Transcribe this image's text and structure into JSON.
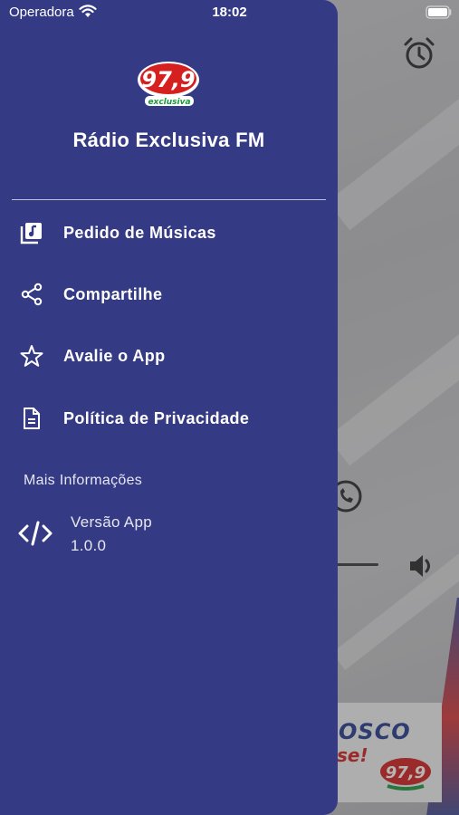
{
  "status_bar": {
    "carrier": "Operadora",
    "time": "18:02"
  },
  "drawer": {
    "logo_text": "97,9",
    "logo_subtext": "exclusiva",
    "title": "Rádio Exclusiva FM",
    "menu": [
      {
        "label": "Pedido de Músicas",
        "icon": "music-library-icon"
      },
      {
        "label": "Compartilhe",
        "icon": "share-icon"
      },
      {
        "label": "Avalie o App",
        "icon": "star-icon"
      },
      {
        "label": "Política de Privacidade",
        "icon": "document-icon"
      }
    ],
    "more_info_label": "Mais Informações",
    "version": {
      "title": "Versão App",
      "value": "1.0.0",
      "icon": "code-icon"
    }
  },
  "background": {
    "banner_text_1": "OSCO",
    "banner_text_2": "se!",
    "banner_logo_text": "97,9"
  },
  "colors": {
    "drawer_bg": "#353a85",
    "text": "#ffffff",
    "logo_red": "#d62020",
    "logo_green": "#1a9a3a"
  }
}
